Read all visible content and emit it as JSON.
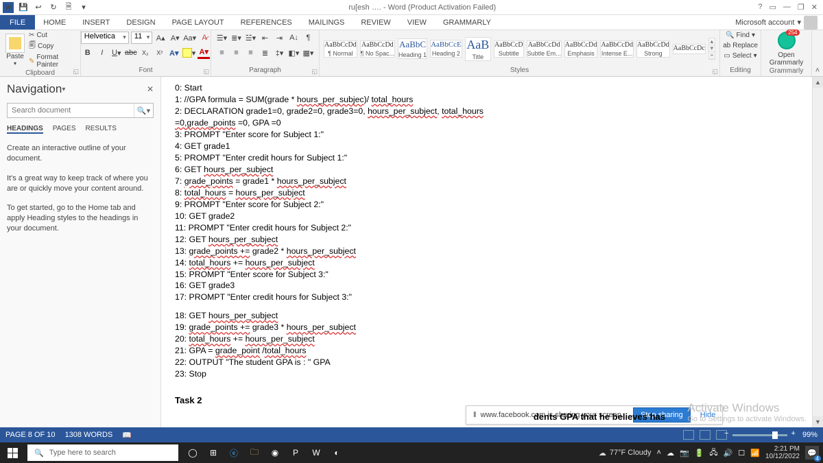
{
  "title": "ru[esh …. - Word (Product Activation Failed)",
  "winctl": {
    "help": "?",
    "min": "—",
    "max": "❐",
    "close": "✕",
    "ribexp": "�⤢"
  },
  "menu": {
    "file": "FILE",
    "tabs": [
      "HOME",
      "INSERT",
      "DESIGN",
      "PAGE LAYOUT",
      "REFERENCES",
      "MAILINGS",
      "REVIEW",
      "VIEW",
      "GRAMMARLY"
    ],
    "account": "Microsoft account"
  },
  "ribbon": {
    "clipboard": {
      "label": "Clipboard",
      "paste": "Paste",
      "cut": "Cut",
      "copy": "Copy",
      "fp": "Format Painter"
    },
    "font": {
      "label": "Font",
      "name": "Helvetica",
      "size": "11"
    },
    "paragraph": {
      "label": "Paragraph"
    },
    "styles": {
      "label": "Styles",
      "items": [
        {
          "p": "AaBbCcDd",
          "l": "¶ Normal",
          "cls": ""
        },
        {
          "p": "AaBbCcDd",
          "l": "¶ No Spac...",
          "cls": ""
        },
        {
          "p": "AaBbC",
          "l": "Heading 1",
          "cls": "h1"
        },
        {
          "p": "AaBbCcE",
          "l": "Heading 2",
          "cls": "h2"
        },
        {
          "p": "AaB",
          "l": "Title",
          "cls": "tit"
        },
        {
          "p": "AaBbCcD",
          "l": "Subtitle",
          "cls": ""
        },
        {
          "p": "AaBbCcDd",
          "l": "Subtle Em...",
          "cls": ""
        },
        {
          "p": "AaBbCcDd",
          "l": "Emphasis",
          "cls": ""
        },
        {
          "p": "AaBbCcDd",
          "l": "Intense E...",
          "cls": ""
        },
        {
          "p": "AaBbCcDd",
          "l": "Strong",
          "cls": ""
        },
        {
          "p": "AaBbCcDc",
          "l": "",
          "cls": ""
        }
      ]
    },
    "editing": {
      "label": "Editing",
      "find": "Find",
      "replace": "Replace",
      "select": "Select"
    },
    "grammarly": {
      "label": "Grammarly",
      "open": "Open Grammarly",
      "count": "254"
    }
  },
  "nav": {
    "heading": "Navigation",
    "search_ph": "Search document",
    "tabs": [
      "HEADINGS",
      "PAGES",
      "RESULTS"
    ],
    "p1": "Create an interactive outline of your document.",
    "p2": "It's a great way to keep track of where you are or quickly move your content around.",
    "p3": "To get started, go to the Home tab and apply Heading styles to the headings in your document."
  },
  "code_lines": [
    "0: Start",
    "1: //GPA formula = SUM(grade * ~hours_per_subjec~)/ ~total_hours~",
    "2: DECLARATION  grade1=0, grade2=0, grade3=0, ~hours_per_subject~, ~total_hours~",
    "~=0,grade_points~ =0, GPA =0",
    "3: PROMPT \"Enter score for Subject 1:\"",
    "4: GET grade1",
    "5: PROMPT \"Enter credit hours for Subject 1:\"",
    "6: GET ~hours_per_subject~",
    "7: ~grade_points~  =  grade1 *  ~hours_per_subject~",
    "8: ~total_hours~ = ~hours_per_subject~",
    "9: PROMPT \"Enter score for Subject 2:\"",
    "10: GET grade2",
    "11: PROMPT \"Enter credit hours for Subject 2:\"",
    "12: GET ~hours_per_subject~",
    "13: ~grade_points  +=~  grade2 *  ~hours_per_subject~",
    "14: ~total_hours~ += ~hours_per_subject~",
    "15: PROMPT \"Enter score for Subject 3:\"",
    "16: GET grade3",
    "17: PROMPT \"Enter credit hours for Subject 3:\""
  ],
  "code_lines2": [
    "18: GET ~hours_per_subject~",
    "19: ~grade_points  +=~  grade3 *  ~hours_per_subject~",
    "20: ~total_hours~ += ~hours_per_subject~",
    "21: GPA = ~grade_point~ /~total_hours~",
    "22: OUTPUT \"The student GPA is :  \" GPA",
    "23: Stop"
  ],
  "task2": "Task 2",
  "share": {
    "msg": "www.facebook.com is sharing your screen.",
    "stop": "Stop sharing",
    "hide": "Hide"
  },
  "rightdoc": "dents GPA that he believes has",
  "activate": {
    "l1": "Activate Windows",
    "l2": "Go to Settings to activate Windows."
  },
  "status": {
    "page": "PAGE 8 OF 10",
    "words": "1308 WORDS",
    "zoom": "99%"
  },
  "task": {
    "search": "Type here to search",
    "weather": "77°F  Cloudy",
    "time": "2:21 PM",
    "date": "10/12/2022",
    "notif": "4"
  }
}
